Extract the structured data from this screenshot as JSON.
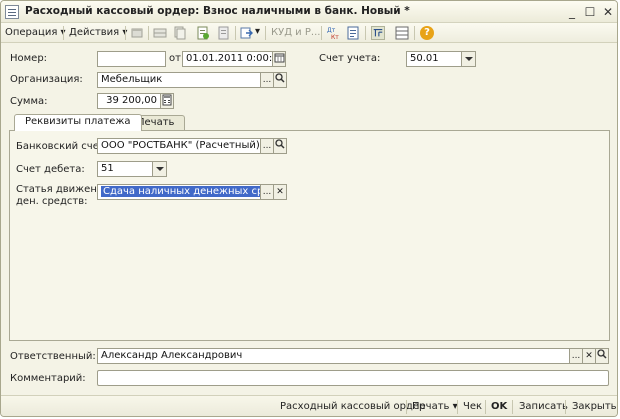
{
  "window": {
    "title": "Расходный кассовый ордер: Взнос наличными в банк. Новый *",
    "minimize": "_",
    "maximize": "☐",
    "close": "✕"
  },
  "toolbar": {
    "operation_label": "Операция",
    "actions_label": "Действия",
    "kud_label": "КУД и Р...",
    "dropdown_arrow": "▾",
    "help_icon": "?"
  },
  "form": {
    "number_label": "Номер:",
    "number_value": "",
    "date_prefix": "от:",
    "date_value": "01.01.2011  0:00:00",
    "account_label": "Счет учета:",
    "account_value": "50.01",
    "org_label": "Организация:",
    "org_value": "Мебельщик",
    "sum_label": "Сумма:",
    "sum_value": "39 200,00",
    "ellipsis": "...",
    "search_glyph": "⚲",
    "clear_glyph": "✕"
  },
  "tabs": [
    {
      "label": "Реквизиты платежа",
      "active": true
    },
    {
      "label": "Печать",
      "active": false
    }
  ],
  "payment": {
    "bank_label": "Банковский счет:",
    "bank_value": "ООО \"РОСТБАНК\" (Расчетный)",
    "debit_label": "Счет дебета:",
    "debit_value": "51",
    "cashflow_label_1": "Статья движения",
    "cashflow_label_2": "ден. средств:",
    "cashflow_value": "Сдача наличных денежных средств в"
  },
  "bottom": {
    "responsible_label": "Ответственный:",
    "responsible_value": "Александр Александрович",
    "comment_label": "Комментарий:",
    "comment_value": ""
  },
  "statusbar": {
    "doc_name": "Расходный кассовый ордер",
    "print_label": "Печать",
    "check_label": "Чек",
    "ok_label": "OK",
    "save_label": "Записать",
    "close_label": "Закрыть"
  },
  "colors": {
    "window_bg": "#f4f3e6",
    "selection": "#4169c8",
    "help_icon": "#e8a317"
  }
}
